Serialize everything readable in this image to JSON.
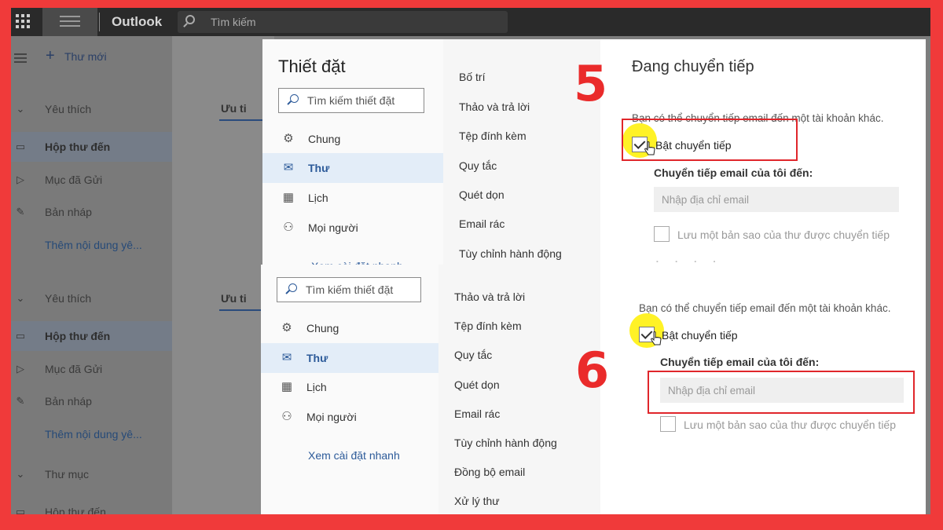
{
  "app": {
    "title": "Outlook",
    "search_placeholder": "Tìm kiếm"
  },
  "leftnav": {
    "new_mail": "Thư mới",
    "top": [
      {
        "label": "Yêu thích",
        "icon": "chevron-down-icon"
      },
      {
        "label": "Hộp thư đến",
        "icon": "inbox-icon"
      },
      {
        "label": "Mục đã Gửi",
        "icon": "send-icon"
      },
      {
        "label": "Bản nháp",
        "icon": "pencil-icon"
      },
      {
        "label": "Thêm nội dung yê..."
      }
    ],
    "bottom": [
      {
        "label": "Yêu thích",
        "icon": "chevron-down-icon"
      },
      {
        "label": "Hộp thư đến",
        "icon": "inbox-icon"
      },
      {
        "label": "Mục đã Gửi",
        "icon": "send-icon"
      },
      {
        "label": "Bản nháp",
        "icon": "pencil-icon"
      },
      {
        "label": "Thêm nội dung yê..."
      },
      {
        "label": "Thư mục",
        "icon": "chevron-down-icon"
      },
      {
        "label": "Hộp thư đến",
        "icon": "inbox-icon"
      }
    ],
    "focused_tab": "Ưu ti"
  },
  "settings": {
    "title": "Thiết đặt",
    "search_placeholder": "Tìm kiếm thiết đặt",
    "categories": [
      {
        "label": "Chung",
        "icon": "gear-icon"
      },
      {
        "label": "Thư",
        "icon": "mail-icon"
      },
      {
        "label": "Lịch",
        "icon": "calendar-icon"
      },
      {
        "label": "Mọi người",
        "icon": "people-icon"
      }
    ],
    "quick_link": "Xem cài đặt nhanh",
    "mail_options_top": [
      "Bố trí",
      "Thảo và trả lời",
      "Tệp đính kèm",
      "Quy tắc",
      "Quét dọn",
      "Email rác",
      "Tùy chỉnh hành động"
    ],
    "mail_options_bottom": [
      "Thảo và trả lời",
      "Tệp đính kèm",
      "Quy tắc",
      "Quét dọn",
      "Email rác",
      "Tùy chỉnh hành động",
      "Đồng bộ email",
      "Xử lý thư"
    ]
  },
  "forwarding": {
    "title": "Đang chuyển tiếp",
    "description": "Bạn có thể chuyển tiếp email đến một tài khoản khác.",
    "enable_label": "Bật chuyển tiếp",
    "enabled": true,
    "forward_to_label": "Chuyển tiếp email của tôi đến:",
    "email_placeholder": "Nhập địa chỉ email",
    "keep_copy_label": "Lưu một bản sao của thư được chuyển tiếp",
    "keep_copy": false
  },
  "steps": {
    "first": "5",
    "second": "6"
  },
  "colors": {
    "border": "#f03a3a",
    "accent": "#2c5a99",
    "highlight": "#fff000",
    "step": "#ea2b2b"
  }
}
